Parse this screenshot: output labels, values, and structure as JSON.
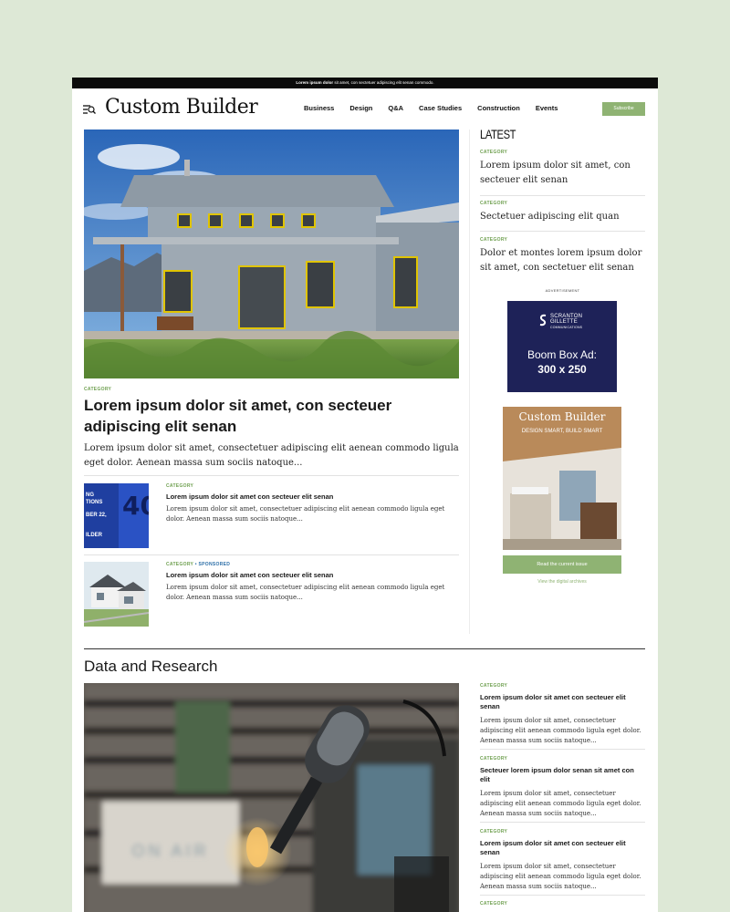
{
  "topbar": {
    "bold": "Lorem ipsum dolor",
    "rest": " sit amet, con sectetuer adipiscing elit senan commodo."
  },
  "header": {
    "logo": "Custom Builder",
    "nav": [
      "Business",
      "Design",
      "Q&A",
      "Case Studies",
      "Construction",
      "Events"
    ],
    "subscribe": "Subscribe"
  },
  "hero": {
    "category": "CATEGORY",
    "title": "Lorem ipsum dolor sit amet, con secteuer adipiscing elit senan",
    "desc": "Lorem ipsum dolor sit amet, consectetuer adipiscing elit aenean commodo ligula eget dolor. Aenean massa sum sociis natoque..."
  },
  "stories": [
    {
      "category": "CATEGORY",
      "sponsored": "",
      "title": "Lorem ipsum dolor sit amet con secteuer elit senan",
      "desc": "Lorem ipsum dolor sit amet, consectetuer adipiscing elit aenean commodo ligula eget dolor. Aenean massa sum sociis natoque..."
    },
    {
      "category": "CATEGORY",
      "sponsored": " • SPONSORED",
      "title": "Lorem ipsum dolor sit amet con secteuer elit senan",
      "desc": "Lorem ipsum dolor sit amet, consectetuer adipiscing elit aenean commodo ligula eget dolor. Aenean massa sum sociis natoque..."
    }
  ],
  "thumb1_text": {
    "l1": "NG",
    "l2": "TIONS",
    "l3": "BER 22,",
    "l4": "ILDER",
    "num": "40"
  },
  "latest": {
    "title": "LATEST",
    "items": [
      {
        "category": "CATEGORY",
        "title": "Lorem ipsum dolor sit amet, con secteuer elit senan"
      },
      {
        "category": "CATEGORY",
        "title": "Sectetuer adipiscing elit quan"
      },
      {
        "category": "CATEGORY",
        "title": "Dolor et montes lorem ipsum dolor sit amet, con sectetuer elit senan"
      }
    ]
  },
  "ad": {
    "label": "ADVERTISEMENT",
    "brand1": "SCRANTON",
    "brand2": "GILLETTE",
    "brand3": "COMMUNICATIONS",
    "line1": "Boom Box Ad:",
    "line2": "300 x 250"
  },
  "magazine": {
    "logo": "Custom Builder",
    "tagline": "DESIGN SMART, BUILD SMART",
    "read_button": "Read the current issue",
    "archives": "View the digital archives"
  },
  "data_research": {
    "title": "Data and Research",
    "photo_text": "ON AIR",
    "items": [
      {
        "category": "CATEGORY",
        "title": "Lorem ipsum dolor sit amet con secteuer elit senan",
        "desc": "Lorem ipsum dolor sit amet, consectetuer adipiscing elit aenean commodo ligula eget dolor. Aenean massa sum sociis natoque..."
      },
      {
        "category": "CATEGORY",
        "title": "Secteuer lorem ipsum dolor senan sit amet con elit",
        "desc": "Lorem ipsum dolor sit amet, consectetuer adipiscing elit aenean commodo ligula eget dolor. Aenean massa sum sociis natoque..."
      },
      {
        "category": "CATEGORY",
        "title": "Lorem ipsum dolor sit amet con secteuer elit senan",
        "desc": "Lorem ipsum dolor sit amet, consectetuer adipiscing elit aenean commodo ligula eget dolor. Aenean massa sum sociis natoque..."
      },
      {
        "category": "CATEGORY",
        "title": "",
        "desc": ""
      }
    ]
  },
  "colors": {
    "accent": "#8fb373",
    "category": "#6fa050",
    "sponsored": "#2d6fa8",
    "ad_bg": "#1e2258"
  }
}
